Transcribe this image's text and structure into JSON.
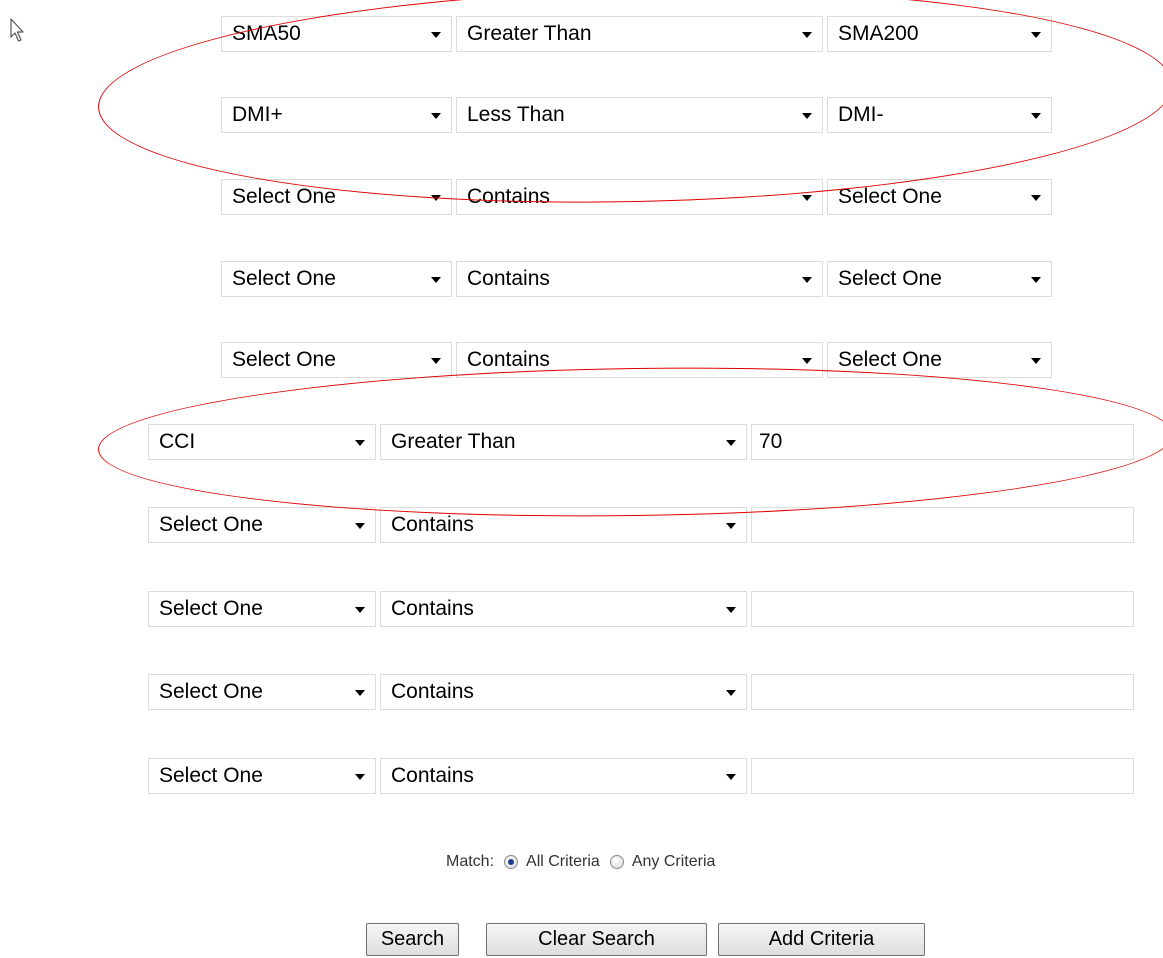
{
  "criteria_rows": [
    {
      "field": "SMA50",
      "operator": "Greater Than",
      "target": "SMA200"
    },
    {
      "field": "DMI+",
      "operator": "Less Than",
      "target": "DMI-"
    },
    {
      "field": "Select One",
      "operator": "Contains",
      "target": "Select One"
    },
    {
      "field": "Select One",
      "operator": "Contains",
      "target": "Select One"
    },
    {
      "field": "Select One",
      "operator": "Contains",
      "target": "Select One"
    }
  ],
  "value_rows": [
    {
      "field": "CCI",
      "operator": "Greater Than",
      "value": "70"
    },
    {
      "field": "Select One",
      "operator": "Contains",
      "value": ""
    },
    {
      "field": "Select One",
      "operator": "Contains",
      "value": ""
    },
    {
      "field": "Select One",
      "operator": "Contains",
      "value": ""
    },
    {
      "field": "Select One",
      "operator": "Contains",
      "value": ""
    }
  ],
  "match": {
    "label": "Match:",
    "selected": "all",
    "all_label": "All Criteria",
    "any_label": "Any Criteria"
  },
  "buttons": {
    "search": "Search",
    "clear": "Clear Search",
    "add": "Add Criteria"
  },
  "annotation_color": "#e00000",
  "icons": [
    "mouse-cursor-icon",
    "chevron-down-icon"
  ]
}
